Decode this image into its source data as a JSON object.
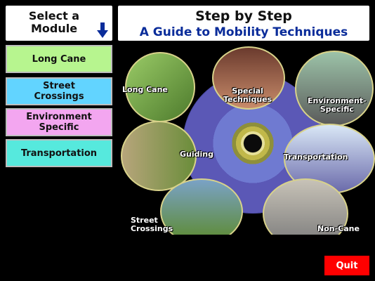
{
  "sidebar": {
    "title": "Select a\nModule",
    "arrow_icon": "arrow-down-icon",
    "modules": [
      {
        "label": "Long Cane",
        "color": "#b7f58f"
      },
      {
        "label": "Street\nCrossings",
        "color": "#62d4ff"
      },
      {
        "label": "Environment\nSpecific",
        "color": "#f3a6f0"
      },
      {
        "label": "Transportation",
        "color": "#56e9dd"
      }
    ]
  },
  "header": {
    "title": "Step by Step",
    "subtitle": "A Guide to Mobility Techniques"
  },
  "main": {
    "labels": {
      "long_cane": "Long Cane",
      "special": "Special\nTechniques",
      "env": "Environment-\nSpecific",
      "guiding": "Guiding",
      "transportation": "Transportation",
      "street": "Street\nCrossings",
      "noncane": "Non-Cane"
    }
  },
  "footer": {
    "quit_label": "Quit"
  },
  "colors": {
    "accent_blue": "#0a2c9a",
    "quit_red": "#ff0000",
    "bubble_border": "#d8d28a"
  }
}
